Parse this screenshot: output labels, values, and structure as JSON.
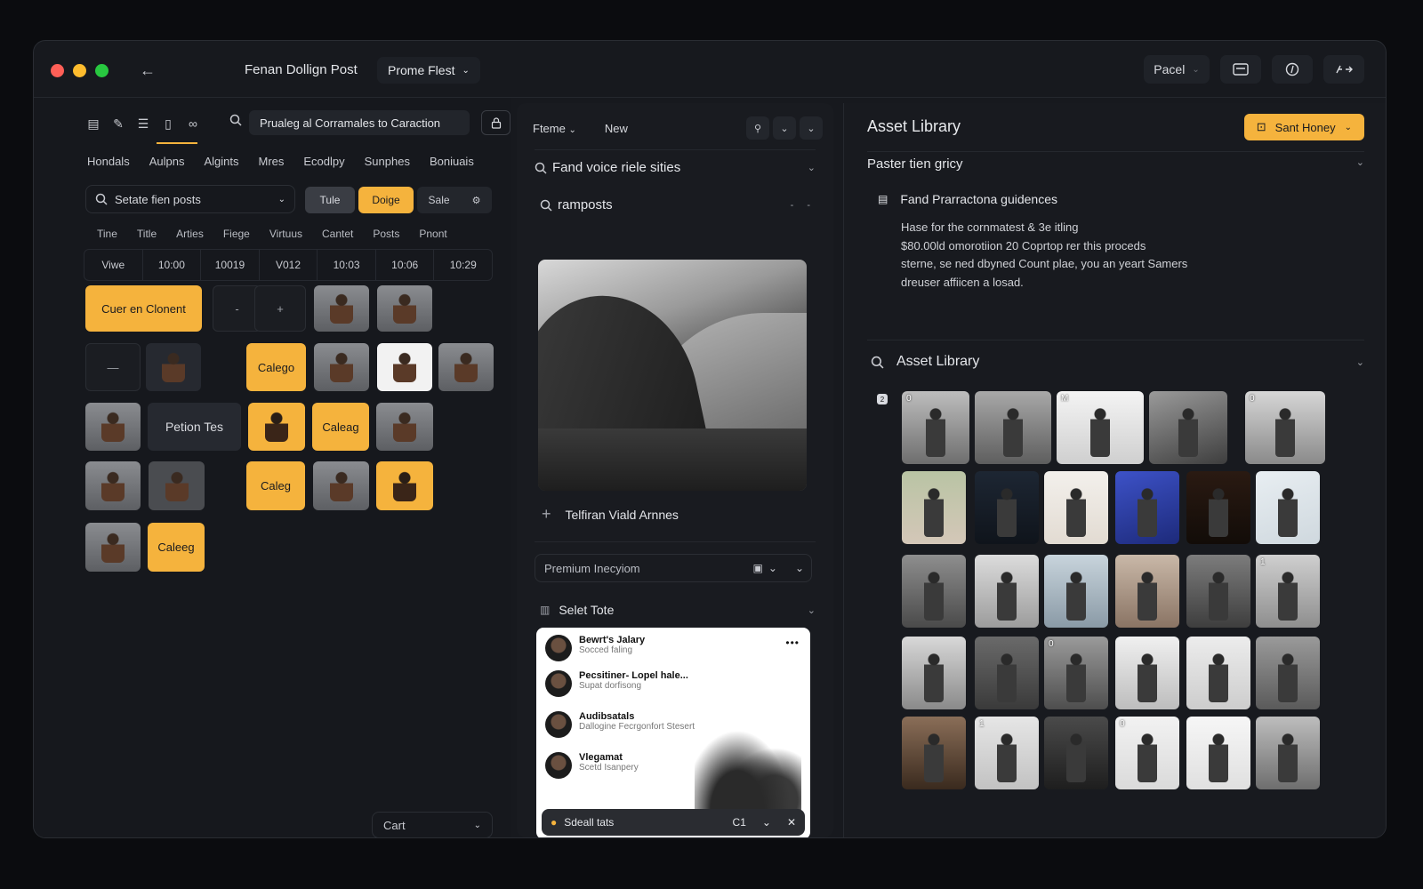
{
  "titlebar": {
    "title": "Fenan Dollign Post",
    "dropdown": "Prome Flest",
    "right_label": "Pacel"
  },
  "left": {
    "search_value": "Prualeg al Corramales to Caraction",
    "tabs": [
      "Hondals",
      "Aulpns",
      "Algints",
      "Mres",
      "Ecodlpy",
      "Sunphes",
      "Boniuais"
    ],
    "filter": "Setate fien posts",
    "segments": [
      "Tule",
      "Doige",
      "Sale"
    ],
    "columns": [
      "Tine",
      "Title",
      "Arties",
      "Fiege",
      "Virtuus",
      "Cantet",
      "Posts",
      "Pnont"
    ],
    "row": [
      "Viwe",
      "10:00",
      "10019",
      "V012",
      "10:03",
      "10:06",
      "10:29"
    ],
    "tiles": {
      "create": "Cuer en Clonent",
      "minus": "-",
      "plus": "+",
      "dash": "—",
      "calego": "Calego",
      "petion": "Petion Tes",
      "caleag": "Caleag",
      "caleg": "Caleg",
      "caleeg": "Caleeg"
    },
    "cart": "Cart"
  },
  "middle": {
    "tab_theme": "Fteme",
    "tab_new": "New",
    "section1": "Fand voice riele sities",
    "section2": "ramposts",
    "add_label": "Telfiran Viald Arnnes",
    "field": "Premium Inecyiom",
    "section3": "Selet Tote",
    "feed": [
      {
        "name": "Bewrt's Jalary",
        "sub": "Socced faling"
      },
      {
        "name": "Pecsitiner- Lopel hale...",
        "sub": "Supat dorfisong"
      },
      {
        "name": "Audibsatals",
        "sub": "Dallogine Fecrgonfort Stesert"
      },
      {
        "name": "Vlegamat",
        "sub": "Scetd Isanpery"
      }
    ],
    "feed_bar": "Sdeall tats",
    "feed_bar_badge": "C1"
  },
  "right": {
    "title": "Asset Library",
    "cta": "Sant Honey",
    "sub": "Paster tien gricy",
    "guide_title": "Fand Prarractona guidences",
    "guide_lines": [
      "Hase for the cornmatest & 3e itling",
      "$80.00ld omorotiion 20 Coprtop rer this proceds",
      "sterne, se ned dbyned Count plae, you an yeart Samers",
      "dreuser affiicen a losad."
    ],
    "library_title": "Asset Library",
    "badge": "2",
    "grid_labels": [
      "0",
      "",
      "M",
      "",
      "0",
      "",
      "",
      "",
      "",
      "",
      "",
      "",
      "",
      "",
      "",
      "",
      "1",
      "",
      "",
      "0",
      "",
      "",
      "",
      "",
      "1",
      "",
      "0",
      "",
      "",
      "1",
      "",
      "",
      "",
      "",
      "",
      "",
      "",
      "",
      "",
      ""
    ]
  },
  "colors": {
    "accent": "#f5b33d",
    "window_bg": "#17191e",
    "close": "#ff5f57",
    "minimize": "#febc2e",
    "maximize": "#28c840"
  }
}
